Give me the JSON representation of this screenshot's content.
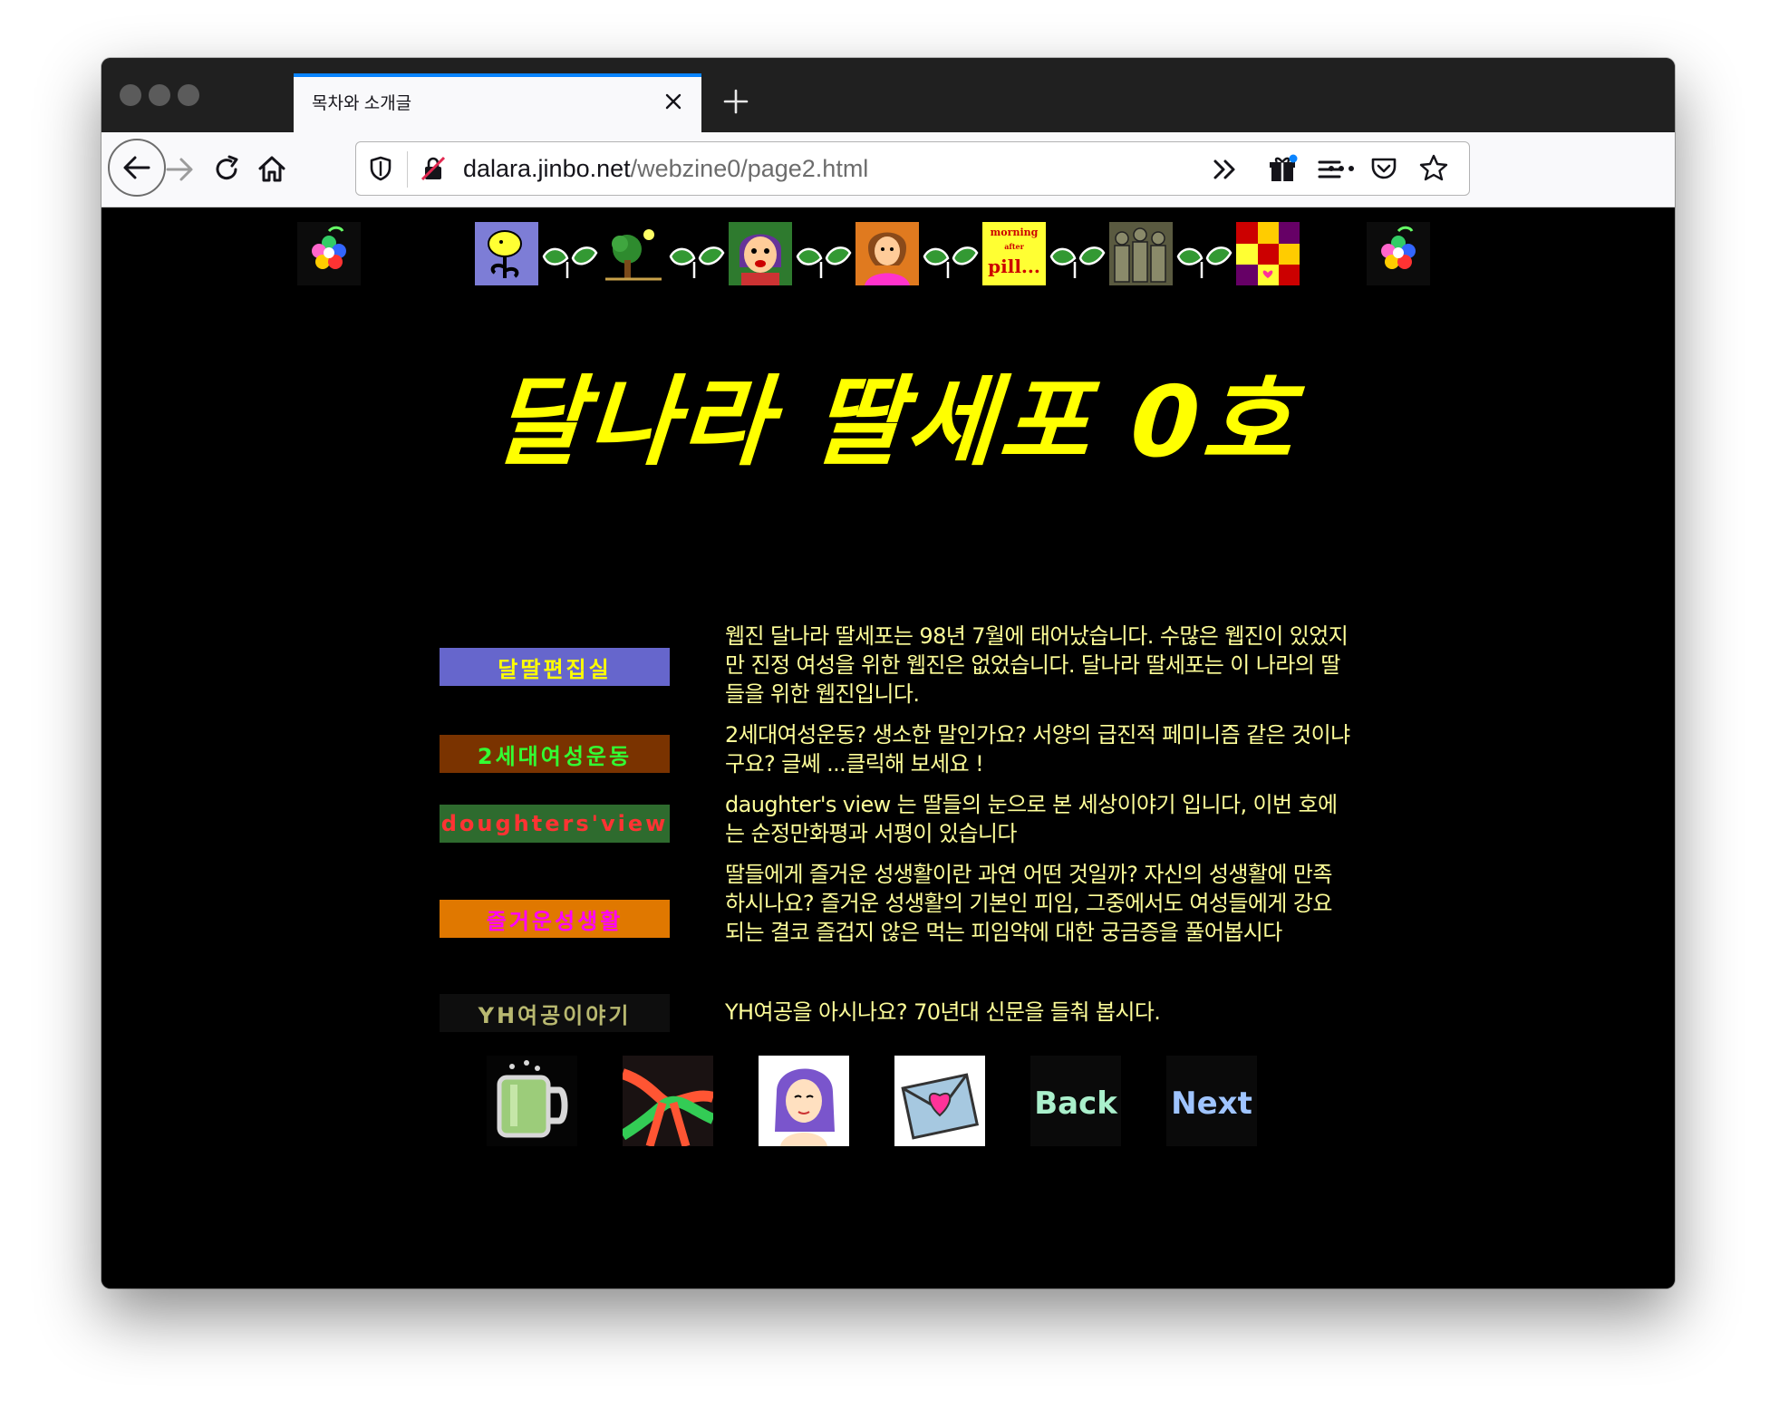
{
  "browser": {
    "tab_title": "목차와 소개글",
    "url_host": "dalara.jinbo.net",
    "url_path": "/webzine0/page2.html"
  },
  "page": {
    "title": "달나라 딸세포 0호",
    "tiles": [
      {
        "icon": "flower-icon"
      },
      {
        "icon": "yellow-flower-icon"
      },
      {
        "icon": "leaves-icon"
      },
      {
        "icon": "tree-icon"
      },
      {
        "icon": "leaves-icon"
      },
      {
        "icon": "girl-face-icon"
      },
      {
        "icon": "leaves-icon"
      },
      {
        "icon": "pink-woman-icon"
      },
      {
        "icon": "leaves-icon"
      },
      {
        "icon": "morning-after-pill-icon",
        "lines": [
          "morning",
          "after",
          "pill..."
        ]
      },
      {
        "icon": "leaves-icon"
      },
      {
        "icon": "crowd-icon"
      },
      {
        "icon": "leaves-icon"
      },
      {
        "icon": "patchwork-icon"
      },
      {
        "icon": "flower-icon"
      }
    ],
    "sections": [
      {
        "label": "달딸편집실",
        "bg": "#6666cc",
        "color": "#ffff00",
        "desc": "웹진 달나라 딸세포는 98년 7월에 태어났습니다. 수많은 웹진이 있었지만 진정 여성을 위한 웹진은 없었습니다. 달나라 딸세포는 이 나라의 딸들을 위한 웹진입니다."
      },
      {
        "label": "2세대여성운동",
        "bg": "#7a3300",
        "color": "#33ff33",
        "desc": "2세대여성운동? 생소한 말인가요? 서양의 급진적 페미니즘 같은 것이냐구요? 글쎄 ...클릭해 보세요 !"
      },
      {
        "label": "doughters'view",
        "bg": "#2e6b2e",
        "color": "#ff3333",
        "desc": "daughter's view 는 딸들의 눈으로 본 세상이야기 입니다, 이번 호에는 순정만화평과 서평이 있습니다"
      },
      {
        "label": "즐거운성생활",
        "bg": "#e07800",
        "color": "#ff00ff",
        "desc": "딸들에게 즐거운 성생활이란 과연 어떤 것일까? 자신의 성생활에 만족하시나요? 즐거운 성생활의 기본인 피임, 그중에서도 여성들에게 강요되는 결코 즐겁지 않은 먹는 피임약에 대한 궁금증을 풀어봅시다"
      },
      {
        "label": "YH여공이야기",
        "bg": "#0e0e0e",
        "color": "#b8b870",
        "desc": "YH여공을 아시나요? 70년대 신문을 들춰 봅시다."
      }
    ],
    "bottom_nav": {
      "icons": [
        "mug-icon",
        "ribbon-icon",
        "woman-portrait-icon",
        "heart-envelope-icon"
      ],
      "back_label": "Back",
      "next_label": "Next"
    }
  },
  "colors": {
    "page_bg": "#000000",
    "heading": "#ffff00",
    "desc_text": "#ffff99",
    "tab_accent": "#0a84ff"
  }
}
